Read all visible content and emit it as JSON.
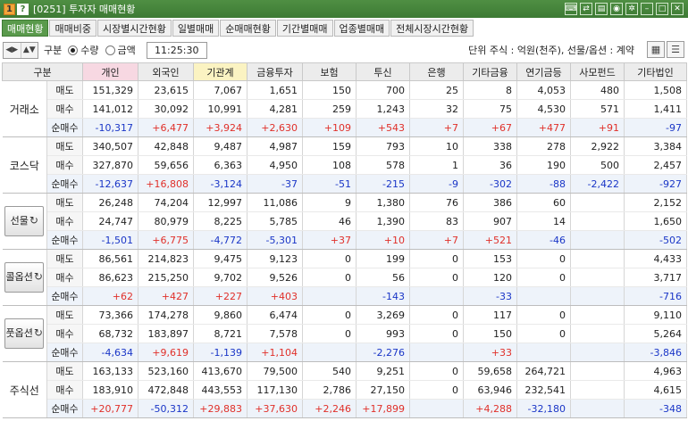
{
  "window": {
    "num_badge": "1",
    "help_badge": "?",
    "title": "[0251] 투자자 매매현황",
    "icons": [
      "keyboard-icon",
      "link-icon",
      "export-icon",
      "camera-icon",
      "gear-icon",
      "minimize-icon",
      "maximize-icon",
      "close-icon"
    ]
  },
  "tabs": [
    "매매현황",
    "매매비중",
    "시장별시간현황",
    "일별매매",
    "순매매현황",
    "기간별매매",
    "업종별매매",
    "전체시장시간현황"
  ],
  "toolbar": {
    "gubun_label": "구분",
    "radio_qty": "수량",
    "radio_amt": "금액",
    "time": "11:25:30",
    "unit_text": "단위 주식 : 억원(천주), 선물/옵션 : 계약"
  },
  "table": {
    "headers": [
      "구분",
      "",
      "개인",
      "외국인",
      "기관계",
      "금융투자",
      "보험",
      "투신",
      "은행",
      "기타금융",
      "연기금등",
      "사모펀드",
      "기타법인"
    ],
    "sub_labels": [
      "매도",
      "매수",
      "순매수"
    ],
    "groups": [
      {
        "name": "거래소",
        "button": false,
        "rows": [
          [
            "151,329",
            "23,615",
            "7,067",
            "1,651",
            "150",
            "700",
            "25",
            "8",
            "4,053",
            "480",
            "1,508"
          ],
          [
            "141,012",
            "30,092",
            "10,991",
            "4,281",
            "259",
            "1,243",
            "32",
            "75",
            "4,530",
            "571",
            "1,411"
          ],
          [
            "-10,317",
            "+6,477",
            "+3,924",
            "+2,630",
            "+109",
            "+543",
            "+7",
            "+67",
            "+477",
            "+91",
            "-97"
          ]
        ]
      },
      {
        "name": "코스닥",
        "button": false,
        "rows": [
          [
            "340,507",
            "42,848",
            "9,487",
            "4,987",
            "159",
            "793",
            "10",
            "338",
            "278",
            "2,922",
            "3,384"
          ],
          [
            "327,870",
            "59,656",
            "6,363",
            "4,950",
            "108",
            "578",
            "1",
            "36",
            "190",
            "500",
            "2,457"
          ],
          [
            "-12,637",
            "+16,808",
            "-3,124",
            "-37",
            "-51",
            "-215",
            "-9",
            "-302",
            "-88",
            "-2,422",
            "-927"
          ]
        ]
      },
      {
        "name": "선물",
        "button": true,
        "rows": [
          [
            "26,248",
            "74,204",
            "12,997",
            "11,086",
            "9",
            "1,380",
            "76",
            "386",
            "60",
            "",
            "2,152"
          ],
          [
            "24,747",
            "80,979",
            "8,225",
            "5,785",
            "46",
            "1,390",
            "83",
            "907",
            "14",
            "",
            "1,650"
          ],
          [
            "-1,501",
            "+6,775",
            "-4,772",
            "-5,301",
            "+37",
            "+10",
            "+7",
            "+521",
            "-46",
            "",
            "-502"
          ]
        ]
      },
      {
        "name": "콜옵션",
        "button": true,
        "rows": [
          [
            "86,561",
            "214,823",
            "9,475",
            "9,123",
            "0",
            "199",
            "0",
            "153",
            "0",
            "",
            "4,433"
          ],
          [
            "86,623",
            "215,250",
            "9,702",
            "9,526",
            "0",
            "56",
            "0",
            "120",
            "0",
            "",
            "3,717"
          ],
          [
            "+62",
            "+427",
            "+227",
            "+403",
            "",
            "-143",
            "",
            "-33",
            "",
            "",
            "-716"
          ]
        ]
      },
      {
        "name": "풋옵션",
        "button": true,
        "rows": [
          [
            "73,366",
            "174,278",
            "9,860",
            "6,474",
            "0",
            "3,269",
            "0",
            "117",
            "0",
            "",
            "9,110"
          ],
          [
            "68,732",
            "183,897",
            "8,721",
            "7,578",
            "0",
            "993",
            "0",
            "150",
            "0",
            "",
            "5,264"
          ],
          [
            "-4,634",
            "+9,619",
            "-1,139",
            "+1,104",
            "",
            "-2,276",
            "",
            "+33",
            "",
            "",
            "-3,846"
          ]
        ]
      },
      {
        "name": "주식선",
        "button": false,
        "rows": [
          [
            "163,133",
            "523,160",
            "413,670",
            "79,500",
            "540",
            "9,251",
            "0",
            "59,658",
            "264,721",
            "",
            "4,963"
          ],
          [
            "183,910",
            "472,848",
            "443,553",
            "117,130",
            "2,786",
            "27,150",
            "0",
            "63,946",
            "232,541",
            "",
            "4,615"
          ],
          [
            "+20,777",
            "-50,312",
            "+29,883",
            "+37,630",
            "+2,246",
            "+17,899",
            "",
            "+4,288",
            "-32,180",
            "",
            "-348"
          ]
        ]
      }
    ]
  }
}
